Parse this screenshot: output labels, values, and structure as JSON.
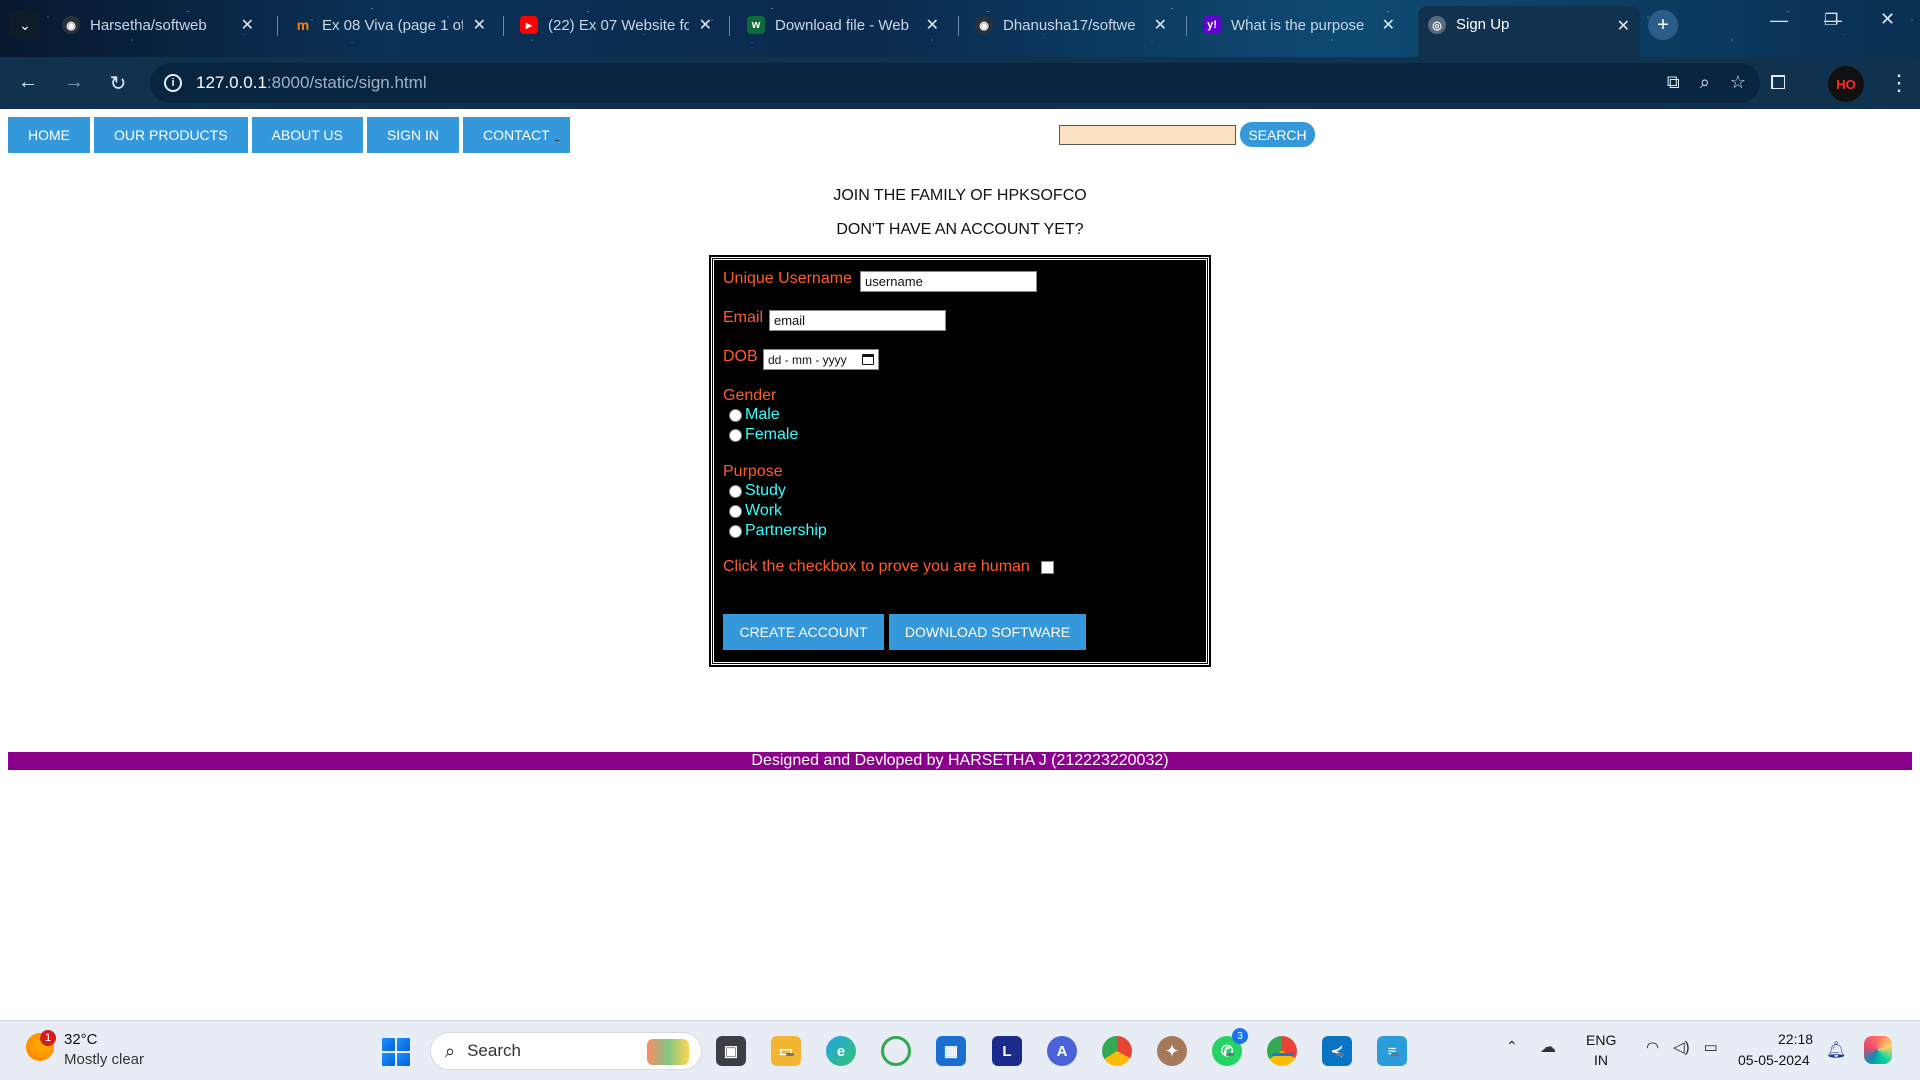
{
  "browser": {
    "tabs": [
      {
        "label": "Harsetha/softweb",
        "icon": "github-icon"
      },
      {
        "label": "Ex 08 Viva (page 1 of",
        "icon": "moodle-icon"
      },
      {
        "label": "(22) Ex 07 Website fo",
        "icon": "youtube-icon"
      },
      {
        "label": "Download file - Web",
        "icon": "w-icon"
      },
      {
        "label": "Dhanusha17/softwe",
        "icon": "github-icon"
      },
      {
        "label": "What is the purpose",
        "icon": "yahoo-icon"
      },
      {
        "label": "Sign Up",
        "icon": "globe-icon"
      }
    ],
    "url_host": "127.0.0.1",
    "url_path": ":8000/static/sign.html"
  },
  "nav": {
    "items": [
      "HOME",
      "OUR PRODUCTS",
      "ABOUT US",
      "SIGN IN",
      "CONTACT"
    ],
    "search_label": "SEARCH",
    "search_value": ""
  },
  "page": {
    "heading1": "JOIN THE FAMILY OF HPKSOFCO",
    "heading2": "DON'T HAVE AN ACCOUNT YET?"
  },
  "form": {
    "username_label": "Unique Username",
    "username_value": "username",
    "email_label": "Email",
    "email_value": "email",
    "dob_label": "DOB",
    "dob_placeholder": "dd - mm - yyyy",
    "gender_label": "Gender",
    "gender_options": [
      "Male",
      "Female"
    ],
    "purpose_label": "Purpose",
    "purpose_options": [
      "Study",
      "Work",
      "Partnership"
    ],
    "human_check_label": "Click the checkbox to prove you are human",
    "create_button": "CREATE ACCOUNT",
    "download_button": "DOWNLOAD SOFTWARE"
  },
  "footer": {
    "text": "Designed and Devloped by HARSETHA J (212223220032)"
  },
  "taskbar": {
    "weather_temp": "32°C",
    "weather_desc": "Mostly clear",
    "weather_badge": "1",
    "search_label": "Search",
    "whatsapp_badge": "3",
    "lang_line1": "ENG",
    "lang_line2": "IN",
    "time": "22:18",
    "date": "05-05-2024"
  },
  "colors": {
    "nav_button": "#3498db",
    "form_label": "#ff5c2b",
    "radio_label": "#33ffff",
    "footer_bar": "#8b008b",
    "search_input_bg": "#fbe3c2"
  }
}
